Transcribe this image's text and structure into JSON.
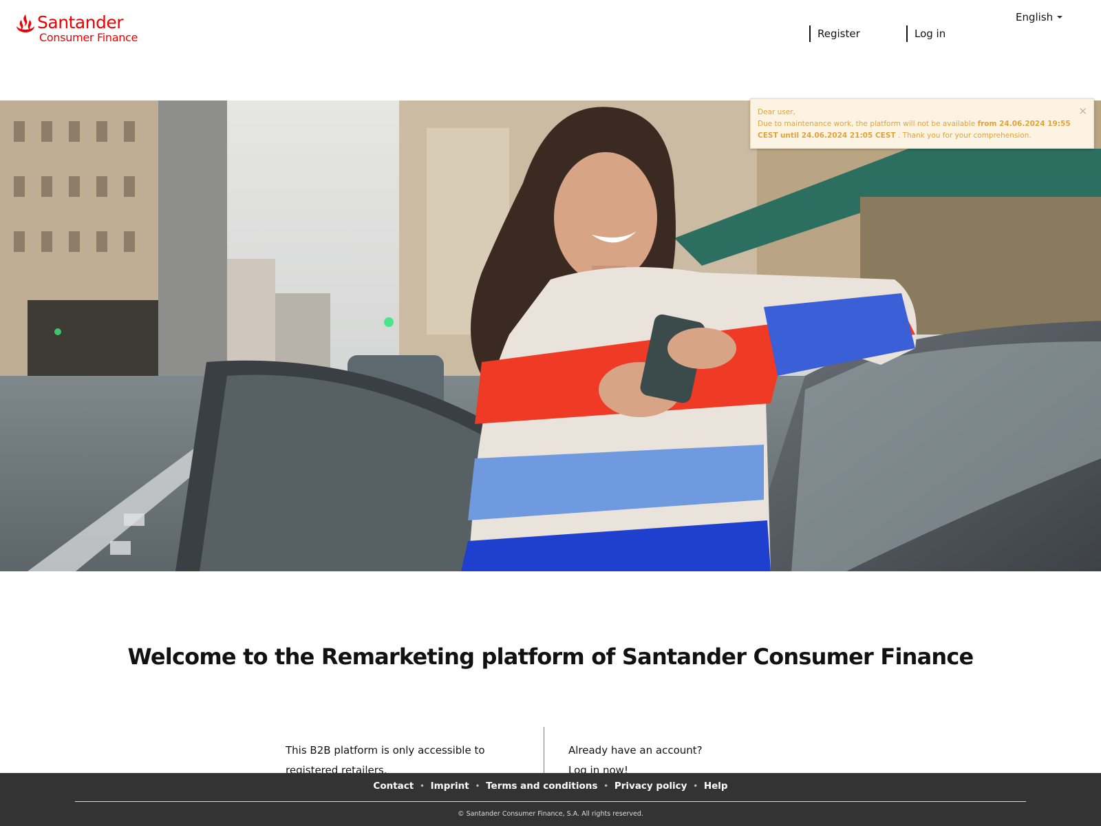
{
  "header": {
    "logo_brand": "Santander",
    "logo_sub": "Consumer Finance",
    "register_label": "Register",
    "login_label": "Log in",
    "language": "English"
  },
  "alert": {
    "greeting": "Dear user,",
    "text_before": "Due to maintenance work, the platform will not be available",
    "from_text": "from 24.06.2024 19:55 CEST",
    "until_text": "until 24.06.2024 21:05 CEST",
    "text_after": ". Thank you for your comprehension.",
    "close_symbol": "×"
  },
  "main": {
    "welcome_title": "Welcome to the Remarketing platform of Santander Consumer Finance",
    "left_text": "This B2B platform is only accessible to registered retailers.",
    "right_question": "Already have an account?",
    "right_link": "Log in now!"
  },
  "footer": {
    "links": [
      "Contact",
      "Imprint",
      "Terms and conditions",
      "Privacy policy",
      "Help"
    ],
    "separator": "•",
    "copyright": "© Santander Consumer Finance, S.A. All rights reserved."
  },
  "colors": {
    "brand_red": "#ec0000",
    "alert_bg": "#fdf3e3",
    "alert_text": "#e0a33a",
    "footer_bg": "#333333"
  }
}
